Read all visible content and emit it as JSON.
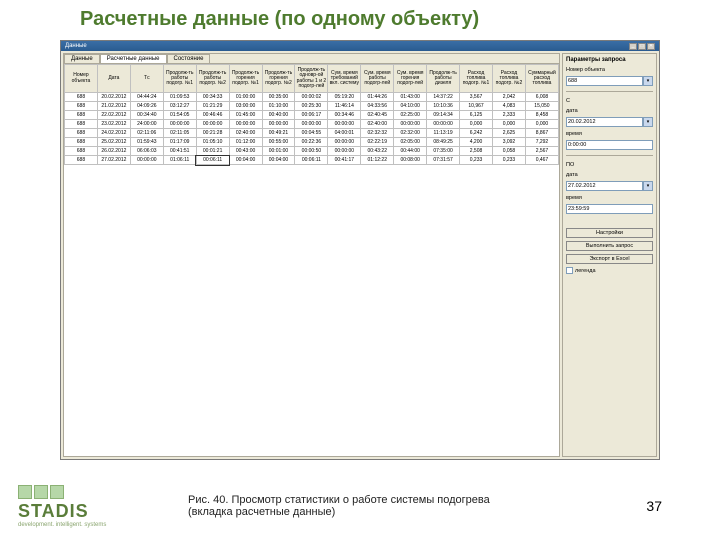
{
  "slide": {
    "title": "Расчетные данные (по одному объекту)",
    "caption_line1": "Рис. 40. Просмотр статистики о работе системы подогрева",
    "caption_line2": "(вкладка расчетные данные)",
    "page_number": "37",
    "logo_text": "STADIS",
    "logo_sub": "development. intelligent. systems"
  },
  "window": {
    "title": "Данные",
    "close": "✕",
    "min": "_",
    "max": "□"
  },
  "tabs": [
    {
      "label": "Данные"
    },
    {
      "label": "Расчетные данные"
    },
    {
      "label": "Состояние"
    }
  ],
  "columns": [
    "Номер объекта",
    "Дата",
    "Tс",
    "Продолж-ть работы подогр. №1",
    "Продолж-ть работы подогр. №2",
    "Продолж-ть горения подогр. №1",
    "Продолж-ть горения подогр. №2",
    "Продолж-ть одновр-ой работы 1 и 2 подогр-лей",
    "Сум. время требований вкл. систему",
    "Сум. время работы подогр-лей",
    "Сум. время горения подогр-лей",
    "Продолж-ть работы дизеля",
    "Расход топлива подогр. №1",
    "Расход топлива подогр. №2",
    "Суммарный расход топлива"
  ],
  "rows": [
    [
      "688",
      "20.02.2012",
      "04:44:24",
      "01:09:53",
      "00:34:33",
      "01:00:00",
      "00:35:00",
      "00:00:02",
      "05:19:20",
      "01:44:26",
      "01:43:00",
      "14:37:22",
      "3,567",
      "2,042",
      "6,008"
    ],
    [
      "688",
      "21.02.2012",
      "04:09:26",
      "03:12:27",
      "01:21:29",
      "03:00:00",
      "01:10:00",
      "00:25:30",
      "11:46:14",
      "04:33:56",
      "04:10:00",
      "10:10:36",
      "10,967",
      "4,083",
      "15,050"
    ],
    [
      "688",
      "22.02.2012",
      "00:34:40",
      "01:54:05",
      "00:46:46",
      "01:45:00",
      "00:40:00",
      "00:06:17",
      "00:34:46",
      "02:40:45",
      "02:25:00",
      "09:14:34",
      "6,125",
      "2,333",
      "8,458"
    ],
    [
      "688",
      "23.02.2012",
      "24:00:00",
      "00:00:00",
      "00:00:00",
      "00:00:00",
      "00:00:00",
      "00:00:00",
      "00:00:00",
      "02:40:00",
      "00:00:00",
      "00:00:00",
      "0,000",
      "0,000",
      "0,000"
    ],
    [
      "688",
      "24.02.2012",
      "02:11:06",
      "02:11:05",
      "00:21:28",
      "02:40:00",
      "00:49:21",
      "00:04:55",
      "04:00:01",
      "02:32:32",
      "02:32:00",
      "11:13:19",
      "6,242",
      "2,625",
      "8,867"
    ],
    [
      "688",
      "25.02.2012",
      "01:59:43",
      "01:17:09",
      "01:05:10",
      "01:12:00",
      "00:55:00",
      "00:22:36",
      "00:00:00",
      "02:22:19",
      "02:05:00",
      "08:49:25",
      "4,200",
      "3,092",
      "7,292"
    ],
    [
      "688",
      "26.02.2012",
      "06:06:03",
      "00:41:51",
      "00:01:21",
      "00:43:00",
      "00:01:00",
      "00:00:50",
      "00:00:00",
      "00:43:22",
      "00:44:00",
      "07:35:00",
      "2,508",
      "0,058",
      "2,567"
    ],
    [
      "688",
      "27.02.2012",
      "00:00:00",
      "01:06:11",
      "00:06:11",
      "00:04:00",
      "00:04:00",
      "00:06:11",
      "00:41:17",
      "01:12:22",
      "00:08:00",
      "07:31:57",
      "0,233",
      "0,233",
      "0,467"
    ]
  ],
  "panel": {
    "heading": "Параметры запроса",
    "object_label": "Номер объекта",
    "object_value": "688",
    "from_label": "С",
    "from_date_label": "дата",
    "from_date_value": "20.02.2012",
    "from_time_label": "время",
    "from_time_value": "0:00:00",
    "to_label": "ПО",
    "to_date_label": "дата",
    "to_date_value": "27.02.2012",
    "to_time_label": "время",
    "to_time_value": "23:59:59",
    "btn_settings": "Настройки",
    "btn_run": "Выполнить запрос",
    "btn_export": "Экспорт в Excel",
    "legend_label": "легенда"
  }
}
